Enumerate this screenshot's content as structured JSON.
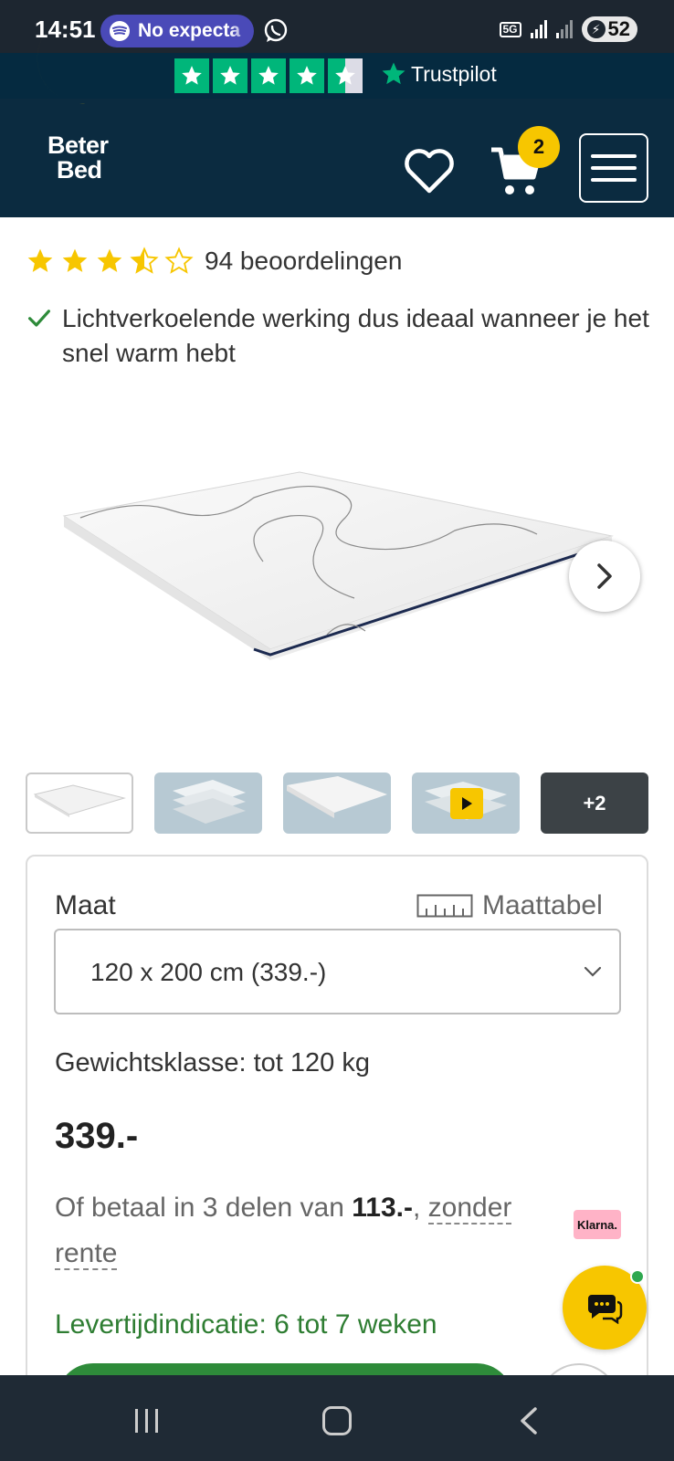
{
  "status_bar": {
    "time": "14:51",
    "media_pill_text": "No expecta",
    "network": "5G",
    "battery": "52"
  },
  "trustpilot": {
    "brand": "Trustpilot",
    "rating": 4.5
  },
  "header": {
    "logo_line1": "Beter",
    "logo_line2": "Bed",
    "cart_count": "2"
  },
  "product": {
    "rating_stars": 3.5,
    "reviews_label": "94 beoordelingen",
    "usp": "Lichtverkoelende werking dus ideaal wanneer je het snel warm hebt",
    "thumbs_more_label": "+2"
  },
  "purchase": {
    "size_label": "Maat",
    "size_table_label": "Maattabel",
    "selected_size": "120 x 200 cm (339.-)",
    "weight_class": "Gewichtsklasse: tot 120 kg",
    "price": "339.-",
    "installment_prefix": "Of betaal in 3 delen van ",
    "installment_amount": "113.-",
    "installment_comma": ",",
    "installment_link": "zonder rente",
    "klarna_label": "Klarna.",
    "delivery": "Levertijdindicatie: 6 tot 7 weken"
  },
  "colors": {
    "header_bg": "#0b2b40",
    "accent_yellow": "#f7c600",
    "trustpilot_green": "#00b67a",
    "delivery_green": "#2e7d32"
  }
}
